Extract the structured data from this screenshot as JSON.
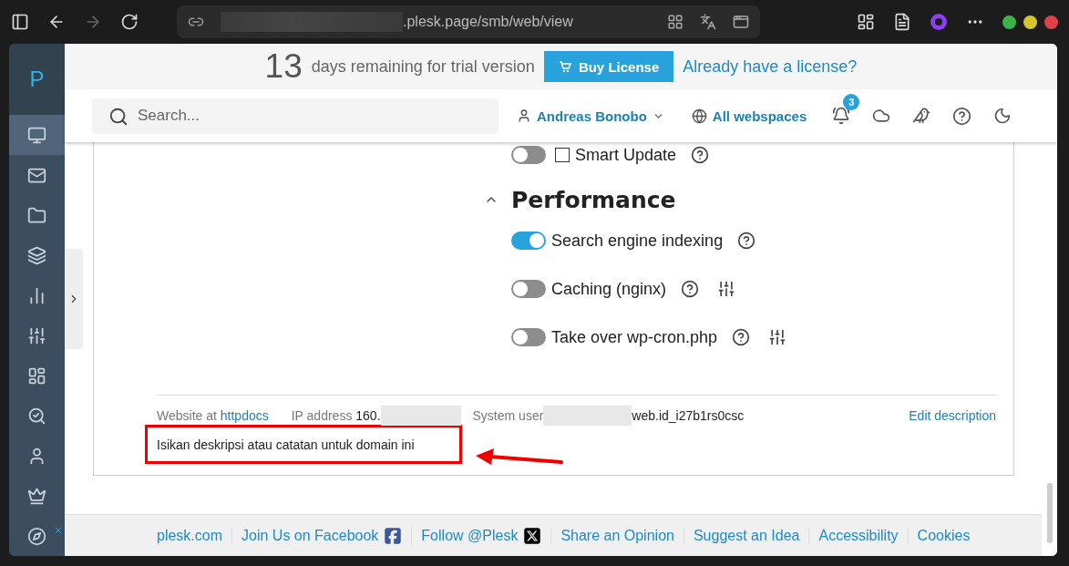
{
  "browser": {
    "address": ".plesk.page/smb/web/view"
  },
  "sidebar": {
    "logo": "P",
    "items": [
      {
        "selected": true
      },
      {
        "selected": false
      },
      {
        "selected": false
      },
      {
        "selected": false
      },
      {
        "selected": false
      },
      {
        "selected": false
      },
      {
        "selected": false
      },
      {
        "selected": false
      },
      {
        "selected": false
      },
      {
        "selected": false
      },
      {
        "selected": false
      }
    ]
  },
  "trial": {
    "days": "13",
    "text": "days remaining for trial version",
    "button": "Buy License",
    "link": "Already have a license?"
  },
  "header": {
    "search": {
      "placeholder": "Search..."
    },
    "user": "Andreas Bonobo",
    "webspaces": "All webspaces",
    "notification_count": "3"
  },
  "smart_update": {
    "label": "Smart Update",
    "on": false,
    "checked": false
  },
  "performance": {
    "title": "Performance",
    "expanded": true,
    "options": [
      {
        "label": "Search engine indexing",
        "on": true,
        "settings": false
      },
      {
        "label": "Caching (nginx)",
        "on": false,
        "settings": true
      },
      {
        "label": "Take over wp-cron.php",
        "on": false,
        "settings": true
      }
    ]
  },
  "info": {
    "website_label": "Website at",
    "website_link": "httpdocs",
    "ip_label": "IP address",
    "ip_value": "160.",
    "user_label": "System user",
    "user_value": "web.id_i27b1rs0csc",
    "edit_link": "Edit description"
  },
  "description": "Isikan deskripsi atau catatan untuk domain ini",
  "footer": [
    {
      "label": "plesk.com",
      "kind": "plain"
    },
    {
      "label": "Join Us on Facebook",
      "kind": "facebook"
    },
    {
      "label": "Follow @Plesk",
      "kind": "x"
    },
    {
      "label": "Share an Opinion",
      "kind": "plain"
    },
    {
      "label": "Suggest an Idea",
      "kind": "plain"
    },
    {
      "label": "Accessibility",
      "kind": "plain"
    },
    {
      "label": "Cookies",
      "kind": "plain"
    }
  ]
}
